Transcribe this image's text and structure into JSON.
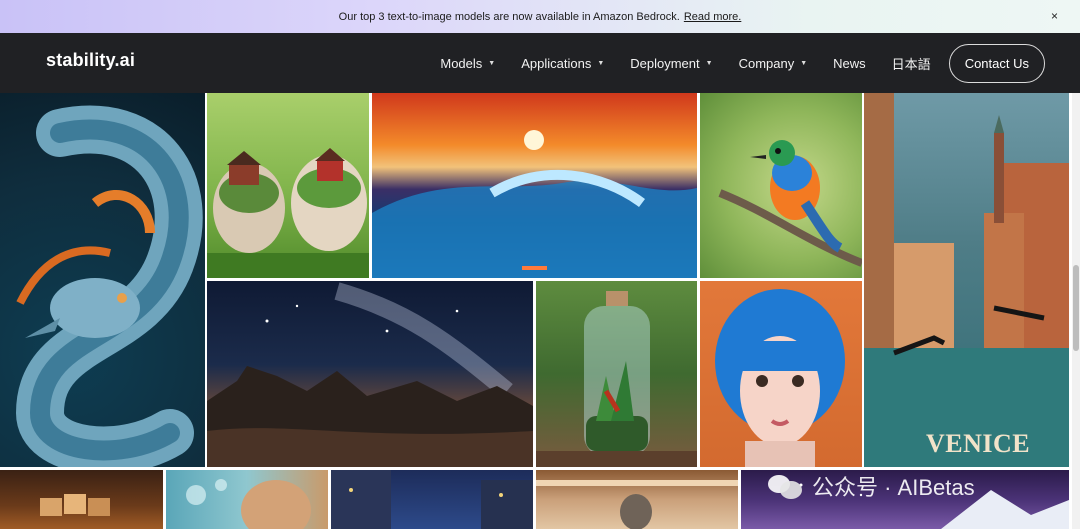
{
  "banner": {
    "text": "Our top 3 text-to-image models are now available in Amazon Bedrock.",
    "link": "Read more.",
    "close": "×"
  },
  "nav": {
    "logo": "stability.ai",
    "items": [
      {
        "label": "Models",
        "caret": "▼"
      },
      {
        "label": "Applications",
        "caret": "▼"
      },
      {
        "label": "Deployment",
        "caret": "▼"
      },
      {
        "label": "Company",
        "caret": "▼"
      },
      {
        "label": "News"
      },
      {
        "label": "日本語"
      }
    ],
    "contact": "Contact Us"
  },
  "gallery": {
    "venice_text": "VENICE"
  },
  "watermark": "公众号 · AIBetas"
}
